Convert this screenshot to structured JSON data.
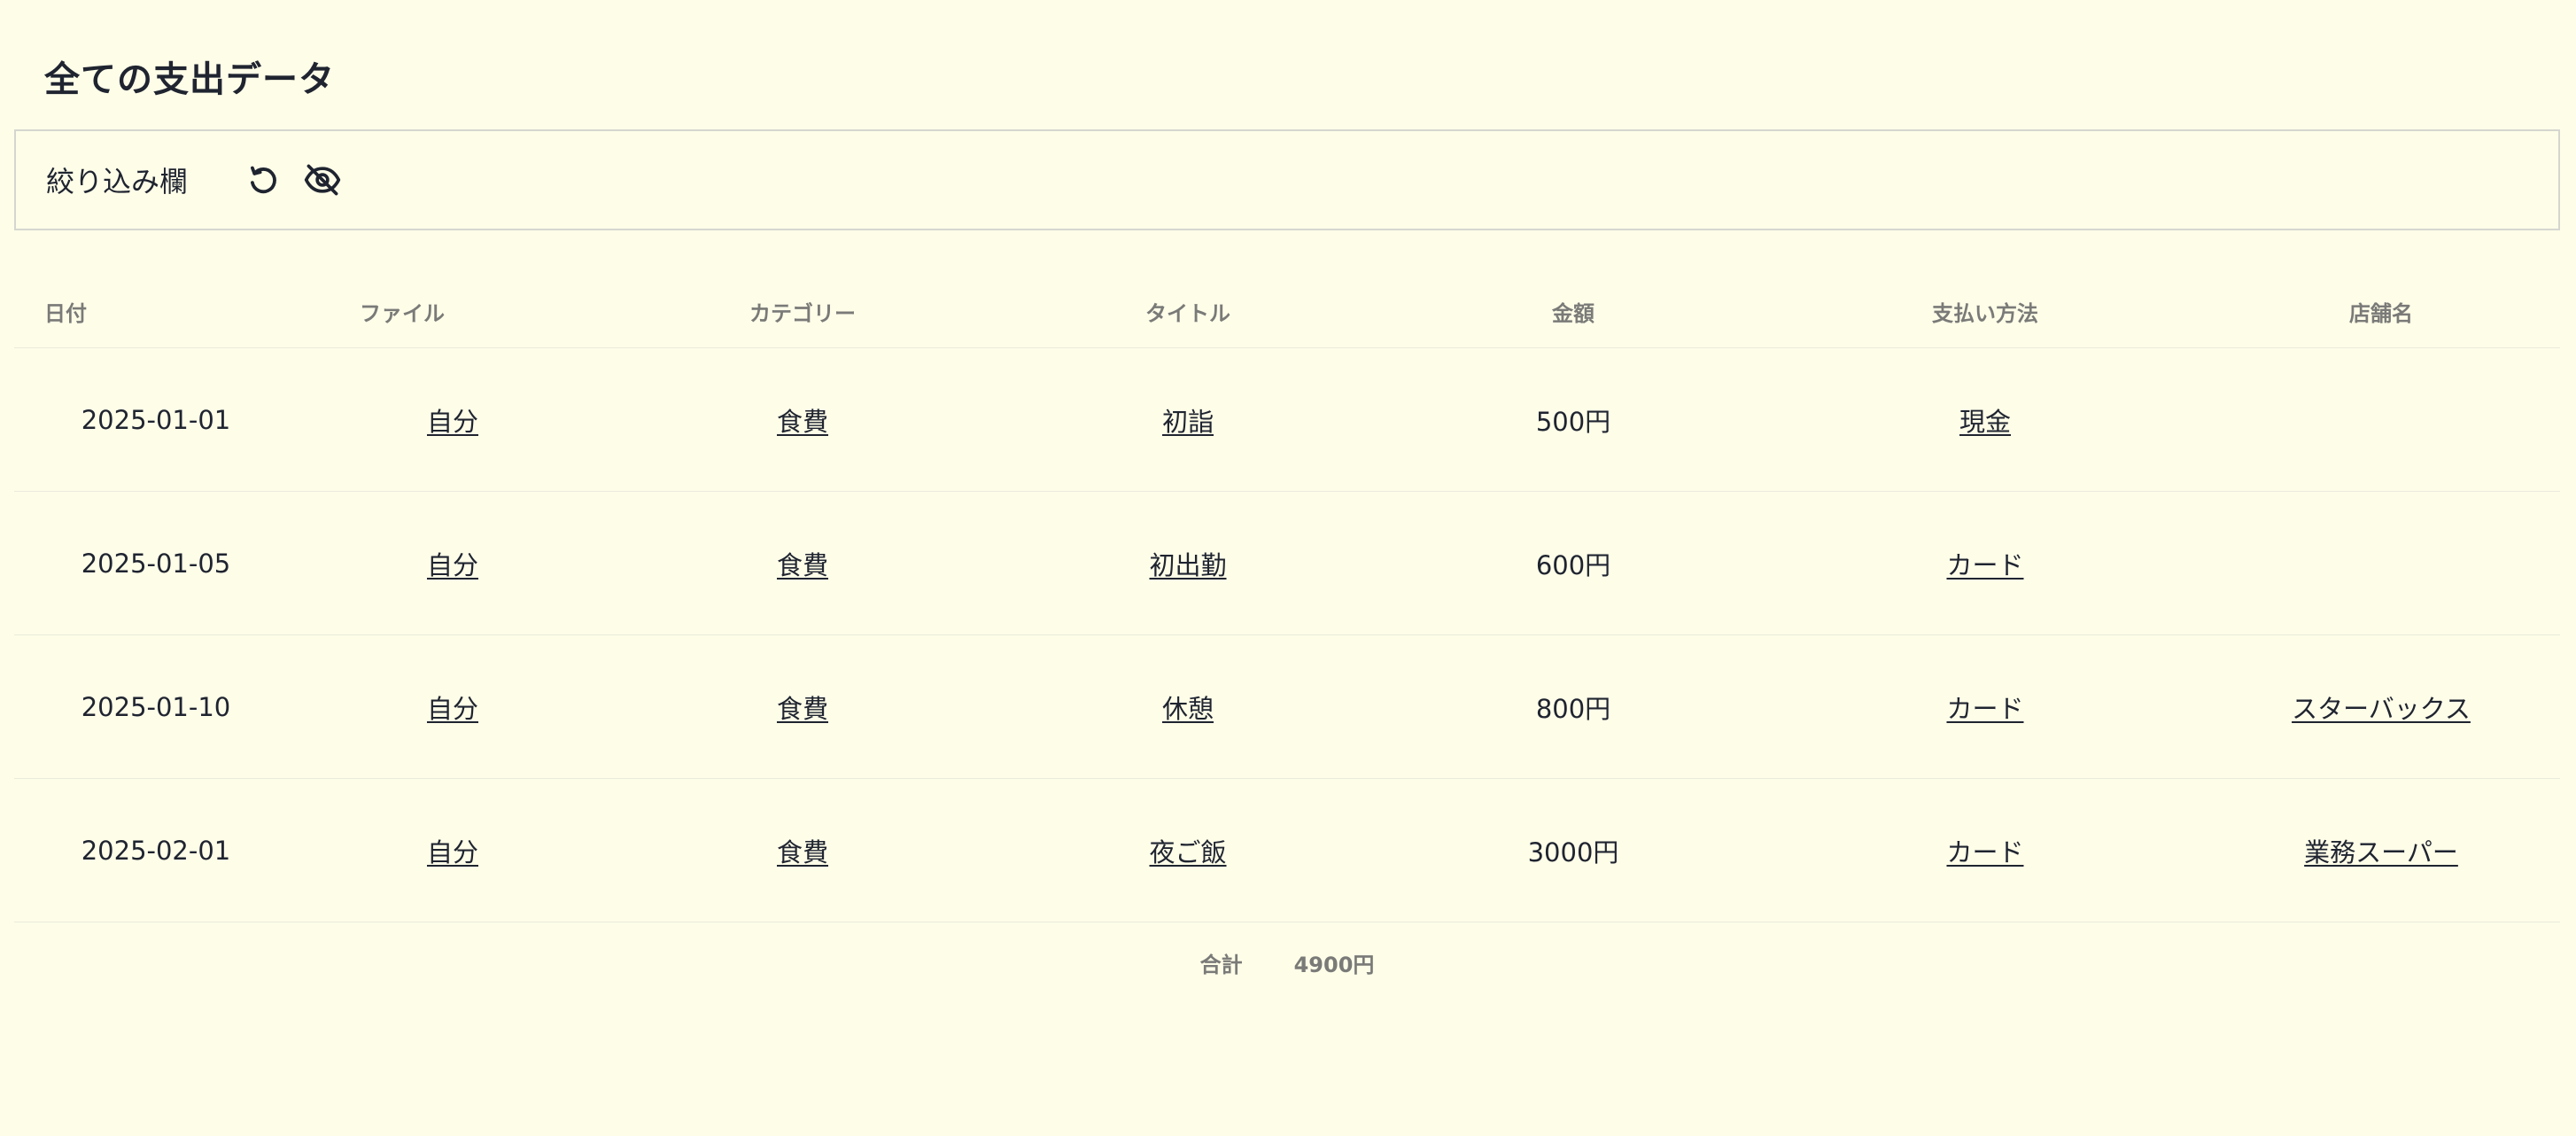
{
  "page": {
    "title": "全ての支出データ"
  },
  "filter": {
    "label": "絞り込み欄",
    "reset_icon": "undo-icon",
    "hide_icon": "eye-off-icon"
  },
  "table": {
    "columns": [
      "日付",
      "ファイル",
      "カテゴリー",
      "タイトル",
      "金額",
      "支払い方法",
      "店舗名"
    ],
    "rows": [
      {
        "date": "2025-01-01",
        "file": "自分",
        "category": "食費",
        "title": "初詣",
        "amount": "500円",
        "payment": "現金",
        "store": ""
      },
      {
        "date": "2025-01-05",
        "file": "自分",
        "category": "食費",
        "title": "初出勤",
        "amount": "600円",
        "payment": "カード",
        "store": ""
      },
      {
        "date": "2025-01-10",
        "file": "自分",
        "category": "食費",
        "title": "休憩",
        "amount": "800円",
        "payment": "カード",
        "store": "スターバックス"
      },
      {
        "date": "2025-02-01",
        "file": "自分",
        "category": "食費",
        "title": "夜ご飯",
        "amount": "3000円",
        "payment": "カード",
        "store": "業務スーパー"
      }
    ]
  },
  "summary": {
    "total_label": "合計",
    "total_value": "4900円"
  },
  "colors": {
    "background": "#fefde8",
    "text": "#1f2430",
    "muted": "#7a7a78",
    "border": "#d6d6d0"
  }
}
